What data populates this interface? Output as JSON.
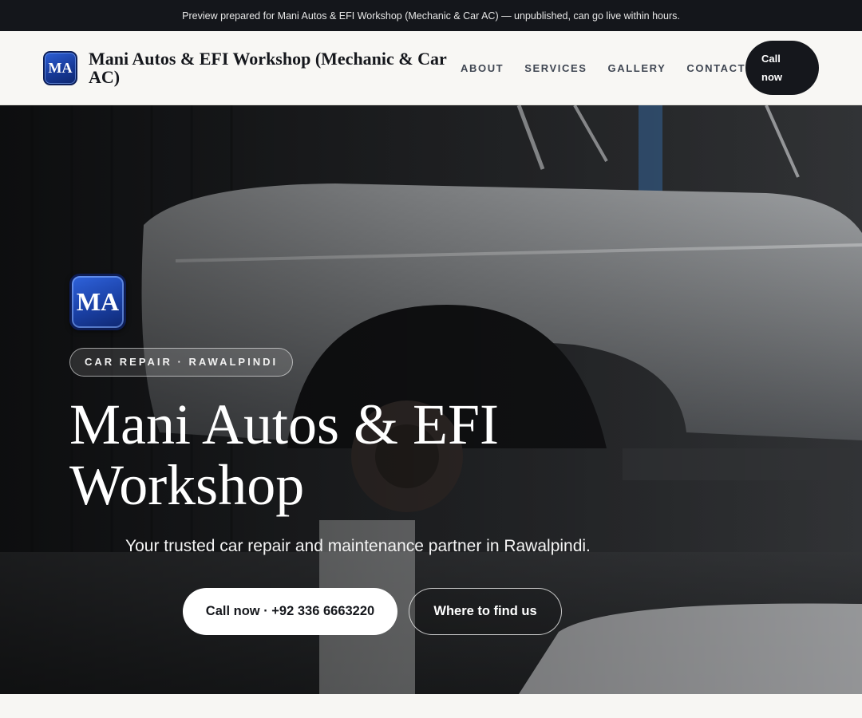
{
  "preview_banner": "Preview prepared for Mani Autos & EFI Workshop (Mechanic & Car AC) — unpublished, can go live within hours.",
  "header": {
    "logo_initials": "MA",
    "brand_name": "Mani Autos & EFI Workshop (Mechanic & Car AC)",
    "nav": [
      {
        "label": "ABOUT"
      },
      {
        "label": "SERVICES"
      },
      {
        "label": "GALLERY"
      },
      {
        "label": "CONTACT"
      }
    ],
    "call_label": "Call now"
  },
  "hero": {
    "logo_initials": "MA",
    "eyebrow": "CAR REPAIR · RAWALPINDI",
    "title": "Mani Autos & EFI Workshop",
    "subtitle": "Your trusted car repair and maintenance partner in Rawalpindi.",
    "primary_cta": "Call now · +92 336 6663220",
    "secondary_cta": "Where to find us",
    "background_image": "classic-car-on-lift-in-workshop"
  },
  "colors": {
    "brand_blue": "#1a40a5",
    "dark": "#15171c",
    "banner_bg": "#14161b",
    "header_bg": "#f8f7f4"
  }
}
